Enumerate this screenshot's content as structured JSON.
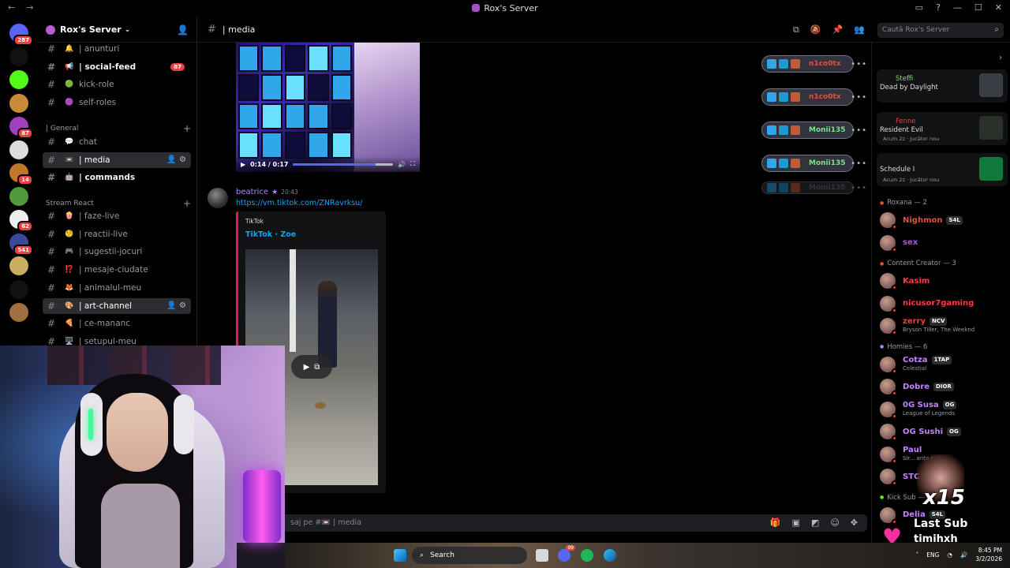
{
  "window": {
    "title": "Rox's Server"
  },
  "server": {
    "name": "Rox's Server"
  },
  "rail": {
    "servers": [
      {
        "name": "discord-home",
        "color": "#5865f2",
        "badge": "287"
      },
      {
        "name": "server-w",
        "color": "#111111",
        "badge": ""
      },
      {
        "name": "server-kick",
        "color": "#53fc18",
        "badge": ""
      },
      {
        "name": "server-avatar-1",
        "color": "#c98a3a",
        "badge": ""
      },
      {
        "name": "server-avatar-2",
        "color": "#a040c0",
        "badge": "87"
      },
      {
        "name": "server-avatar-3",
        "color": "#dddddd",
        "badge": ""
      },
      {
        "name": "server-avatar-4",
        "color": "#c0772a",
        "badge": "14"
      },
      {
        "name": "server-avatar-5",
        "color": "#4f9a3a",
        "badge": ""
      },
      {
        "name": "server-avatar-6",
        "color": "#eeeeee",
        "badge": "62"
      },
      {
        "name": "server-avatar-7",
        "color": "#3a4a9a",
        "badge": "541"
      },
      {
        "name": "server-avatar-8",
        "color": "#c8b060",
        "badge": ""
      },
      {
        "name": "server-w2g",
        "color": "#111111",
        "badge": ""
      },
      {
        "name": "server-avatar-9",
        "color": "#a07040",
        "badge": ""
      }
    ]
  },
  "channels": {
    "top": [
      {
        "emoji": "🔔",
        "label": "| anunturi",
        "bold": false,
        "unread": "",
        "type": "announce"
      },
      {
        "emoji": "📢",
        "label": "| social-feed",
        "bold": true,
        "unread": "87",
        "type": "announce"
      },
      {
        "emoji": "🟢",
        "label": "kick-role",
        "bold": false,
        "unread": "",
        "type": "text"
      },
      {
        "emoji": "🟣",
        "label": "self-roles",
        "bold": false,
        "unread": "",
        "type": "text"
      }
    ],
    "category_general": "| General",
    "general": [
      {
        "emoji": "💬",
        "label": "chat",
        "active": false
      },
      {
        "emoji": "📼",
        "label": "| media",
        "active": true
      },
      {
        "emoji": "🤖",
        "label": "| commands",
        "active": false,
        "bold": true
      }
    ],
    "category_stream": "Stream React",
    "stream": [
      {
        "emoji": "🍿",
        "label": "| faze-live"
      },
      {
        "emoji": "🧐",
        "label": "| reactii-live"
      },
      {
        "emoji": "🎮",
        "label": "| sugestii-jocuri"
      },
      {
        "emoji": "⁉️",
        "label": "| mesaje-ciudate"
      },
      {
        "emoji": "🦊",
        "label": "| animalul-meu"
      },
      {
        "emoji": "🎨",
        "label": "| art-channel",
        "active": true
      },
      {
        "emoji": "🍕",
        "label": "| ce-mananc"
      },
      {
        "emoji": "🖥️",
        "label": "| setupul-meu"
      }
    ]
  },
  "chat": {
    "channel_name": "| media",
    "search_placeholder": "Caută Rox's Server",
    "video": {
      "time": "0:14 / 0:17",
      "progress": 0.82
    },
    "message": {
      "author": "beatrice",
      "time": "20:43",
      "link": "https://vm.tiktok.com/ZNRavrksu/",
      "embed_provider": "TikTok",
      "embed_title": "TikTok · Zoe"
    },
    "input_placeholder": "saj pe #📼 | media"
  },
  "overlay": {
    "pills": [
      {
        "name": "n1co0tx",
        "color": "#e0503c"
      },
      {
        "name": "n1co0tx",
        "color": "#e0503c"
      },
      {
        "name": "Monii135",
        "color": "#7ee08a"
      },
      {
        "name": "Monii135",
        "color": "#7ee08a"
      },
      {
        "name": "Monii135",
        "color": "#6a6e78"
      }
    ]
  },
  "members": {
    "activities": [
      {
        "name": "Steffi",
        "detail": "Dead by Daylight"
      },
      {
        "name": "Fenne",
        "detail": "Resident Evil",
        "sub": "Acum 2z · Jucător nou"
      },
      {
        "name": "",
        "detail": "Schedule I",
        "sub": "Acum 2z · Jucător nou"
      }
    ],
    "groups": [
      {
        "title": "Roxana — 2",
        "members": [
          {
            "name": "Nighmon",
            "tag": "S4L",
            "color": "#e0503c",
            "sub": ""
          },
          {
            "name": "sex",
            "tag": "",
            "color": "#a855f7",
            "sub": ""
          }
        ]
      },
      {
        "title": "Content Creator — 3",
        "members": [
          {
            "name": "Kasim",
            "tag": "",
            "color": "#f23f42",
            "sub": ""
          },
          {
            "name": "nicusor7gaming",
            "tag": "",
            "color": "#f23f42",
            "sub": ""
          },
          {
            "name": "zerry",
            "tag": "NCV",
            "color": "#f23f42",
            "sub": "Bryson Tiller, The Weeknd"
          }
        ]
      },
      {
        "title": "Homies — 6",
        "members": [
          {
            "name": "Cotza",
            "tag": "1TAP",
            "color": "#c084fc",
            "sub": "Celestial"
          },
          {
            "name": "Dobre",
            "tag": "DIOR",
            "color": "#c084fc",
            "sub": ""
          },
          {
            "name": "0G Susa",
            "tag": "OG",
            "color": "#c084fc",
            "sub": "League of Legends"
          },
          {
            "name": "OG Sushi",
            "tag": "OG",
            "color": "#c084fc",
            "sub": ""
          },
          {
            "name": "Paul",
            "tag": "",
            "color": "#c084fc",
            "sub": "Sir... anța natu"
          },
          {
            "name": "STC",
            "tag": "",
            "color": "#c084fc",
            "sub": ""
          }
        ]
      },
      {
        "title": "Kick Sub — 7",
        "members": [
          {
            "name": "Delia",
            "tag": "S4L",
            "color": "#c084fc",
            "sub": ""
          }
        ]
      }
    ]
  },
  "sub_overlay": {
    "multiplier": "x15",
    "label": "Last Sub",
    "username": "timihxh"
  },
  "taskbar": {
    "search": "Search",
    "lang": "ENG",
    "time": "8:45 PM",
    "date": "3/2/2026",
    "discord_badge": "99"
  }
}
